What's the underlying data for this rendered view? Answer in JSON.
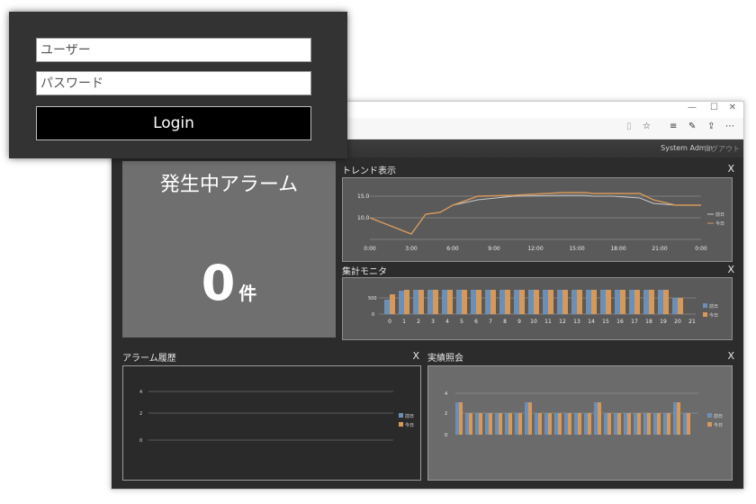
{
  "login": {
    "user_placeholder": "ユーザー",
    "password_placeholder": "パスワード",
    "login_label": "Login"
  },
  "browser": {
    "minimize_icon": "—",
    "maximize_icon": "☐",
    "close_icon": "✕"
  },
  "header": {
    "user_name": "System Admin",
    "logout_label": "ログアウト"
  },
  "alarm": {
    "title": "発生中アラーム",
    "count": "0",
    "unit": "件"
  },
  "panels": {
    "trend": {
      "title": "トレンド表示",
      "close_label": "X"
    },
    "monitor": {
      "title": "集計モニタ",
      "close_label": "X"
    },
    "history": {
      "title": "アラーム履歴",
      "close_label": "X"
    },
    "results": {
      "title": "実績照会",
      "close_label": "X"
    }
  },
  "colors": {
    "yesterday": "#6d8fb3",
    "today": "#d7995a"
  }
}
